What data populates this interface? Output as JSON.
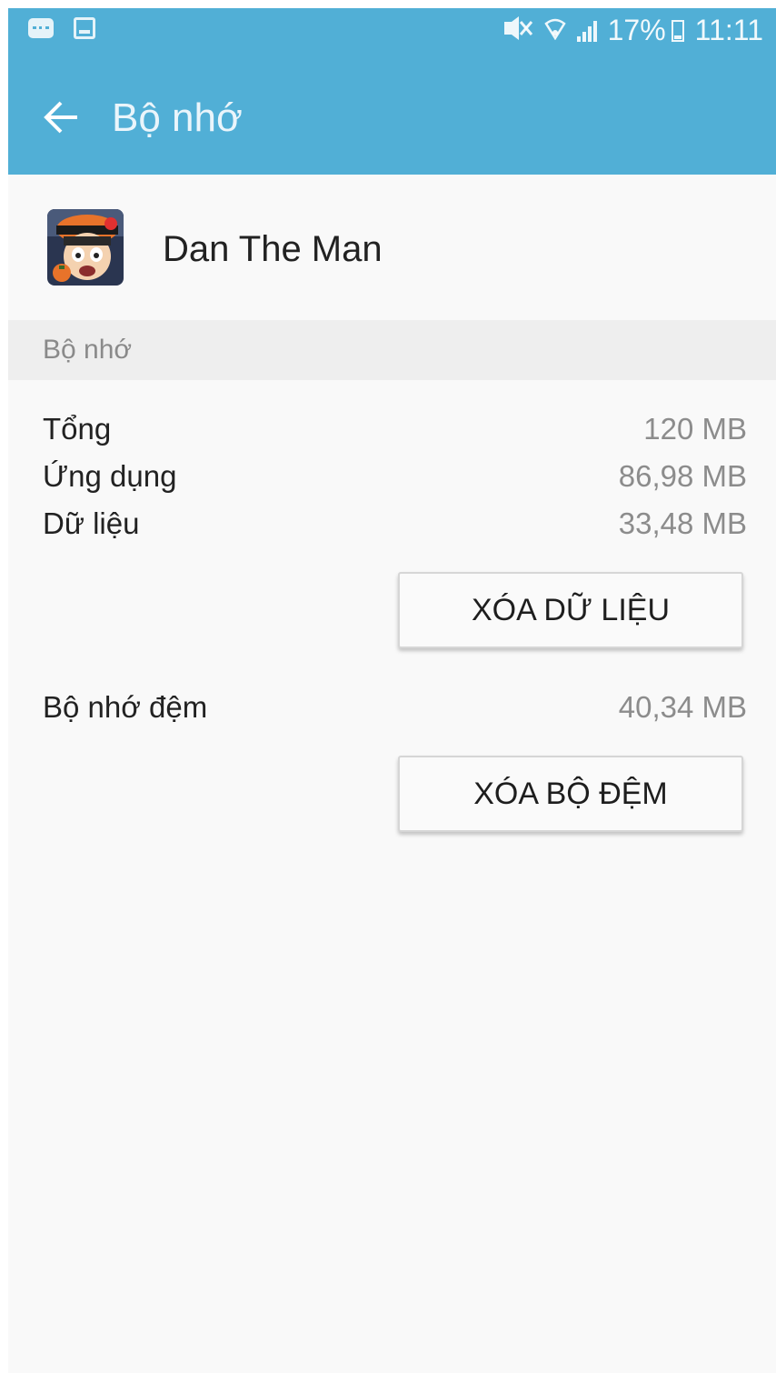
{
  "status_bar": {
    "battery_percent": "17%",
    "time": "11:11",
    "icons": [
      "message-icon",
      "image-icon",
      "mute-icon",
      "wifi-icon",
      "signal-icon",
      "battery-icon"
    ]
  },
  "app_bar": {
    "title": "Bộ nhớ",
    "back_icon": "arrow-left-icon"
  },
  "app": {
    "name": "Dan The Man"
  },
  "storage_section": {
    "title": "Bộ nhớ",
    "rows": [
      {
        "label": "Tổng",
        "value": "120 MB"
      },
      {
        "label": "Ứng dụng",
        "value": "86,98 MB"
      },
      {
        "label": "Dữ liệu",
        "value": "33,48 MB"
      }
    ],
    "clear_data_label": "XÓA DỮ LIỆU"
  },
  "cache_section": {
    "label": "Bộ nhớ đệm",
    "value": "40,34 MB",
    "clear_cache_label": "XÓA BỘ ĐỆM"
  },
  "colors": {
    "header": "#51afd6",
    "background": "#f9f9f9",
    "section_header": "#eeeeee"
  }
}
